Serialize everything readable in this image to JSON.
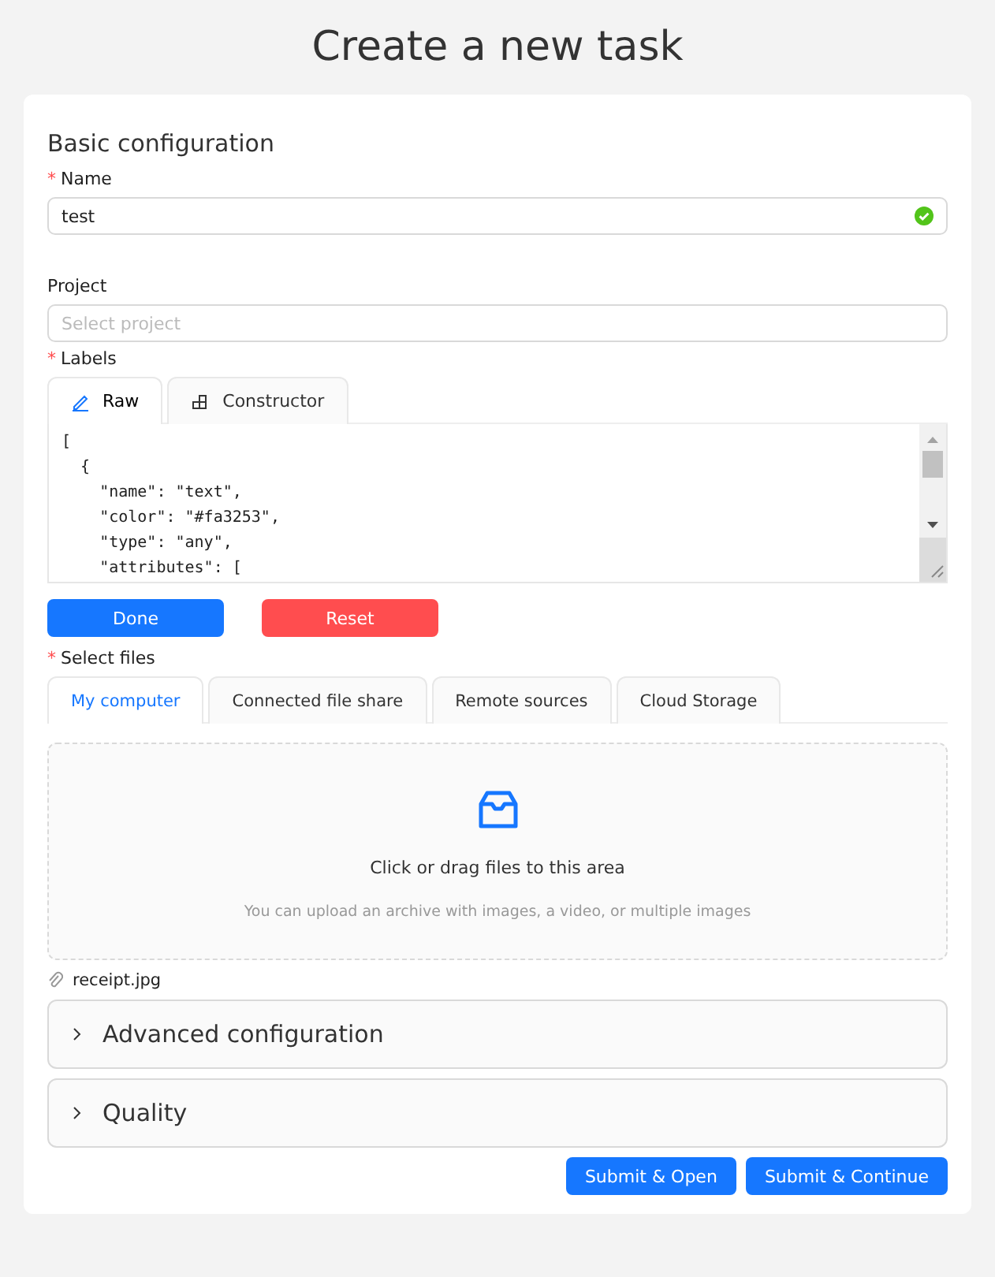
{
  "page_title": "Create a new task",
  "section_title": "Basic configuration",
  "name_field": {
    "label": "Name",
    "required_mark": "*",
    "value": "test",
    "valid": true
  },
  "project_field": {
    "label": "Project",
    "placeholder": "Select project"
  },
  "labels": {
    "label": "Labels",
    "required_mark": "*",
    "tabs": [
      {
        "label": "Raw",
        "kind": "pencil",
        "selected": true
      },
      {
        "label": "Constructor",
        "kind": "blocks",
        "selected": false
      }
    ],
    "code_lines": [
      "[",
      "  {",
      "    \"name\": \"text\",",
      "    \"color\": \"#fa3253\",",
      "    \"type\": \"any\",",
      "    \"attributes\": ["
    ],
    "buttons": [
      {
        "label": "Done",
        "kind": "primary"
      },
      {
        "label": "Reset",
        "kind": "danger"
      }
    ]
  },
  "files": {
    "label": "Select files",
    "required_mark": "*",
    "tabs": [
      {
        "label": "My computer",
        "selected": true
      },
      {
        "label": "Connected file share",
        "selected": false
      },
      {
        "label": "Remote sources",
        "selected": false
      },
      {
        "label": "Cloud Storage",
        "selected": false
      }
    ],
    "drop_title": "Click or drag files to this area",
    "drop_hint": "You can upload an archive with images, a video, or multiple images",
    "attached": [
      "receipt.jpg"
    ]
  },
  "panels": [
    {
      "title": "Advanced configuration",
      "expanded": false
    },
    {
      "title": "Quality",
      "expanded": false
    }
  ],
  "actions": [
    "Submit & Open",
    "Submit & Continue"
  ]
}
